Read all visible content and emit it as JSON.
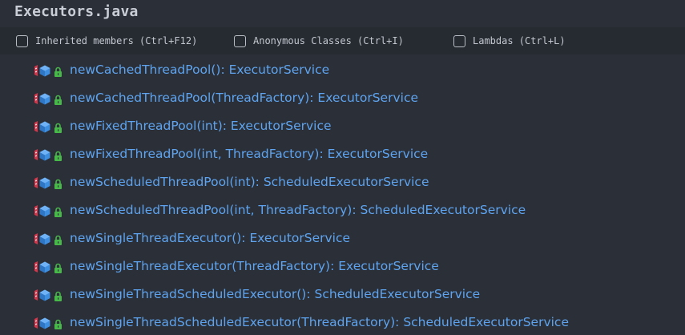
{
  "title": "Executors.java",
  "options": [
    {
      "label": "Inherited members (Ctrl+F12)",
      "checked": false
    },
    {
      "label": "Anonymous Classes (Ctrl+I)",
      "checked": false
    },
    {
      "label": "Lambdas (Ctrl+L)",
      "checked": false
    }
  ],
  "members": [
    {
      "name": "newCachedThreadPool()",
      "type": ": ExecutorService",
      "icon": "static-method-icon",
      "visibility": "lock-icon"
    },
    {
      "name": "newCachedThreadPool(ThreadFactory)",
      "type": ": ExecutorService",
      "icon": "static-method-icon",
      "visibility": "lock-icon"
    },
    {
      "name": "newFixedThreadPool(int)",
      "type": ": ExecutorService",
      "icon": "static-method-icon",
      "visibility": "lock-icon"
    },
    {
      "name": "newFixedThreadPool(int, ThreadFactory)",
      "type": ": ExecutorService",
      "icon": "static-method-icon",
      "visibility": "lock-icon"
    },
    {
      "name": "newScheduledThreadPool(int)",
      "type": ": ScheduledExecutorService",
      "icon": "static-method-icon",
      "visibility": "lock-icon"
    },
    {
      "name": "newScheduledThreadPool(int, ThreadFactory)",
      "type": ": ScheduledExecutorService",
      "icon": "static-method-icon",
      "visibility": "lock-icon"
    },
    {
      "name": "newSingleThreadExecutor()",
      "type": ": ExecutorService",
      "icon": "static-method-icon",
      "visibility": "lock-icon"
    },
    {
      "name": "newSingleThreadExecutor(ThreadFactory)",
      "type": ": ExecutorService",
      "icon": "static-method-icon",
      "visibility": "lock-icon"
    },
    {
      "name": "newSingleThreadScheduledExecutor()",
      "type": ": ScheduledExecutorService",
      "icon": "static-method-icon",
      "visibility": "lock-icon"
    },
    {
      "name": "newSingleThreadScheduledExecutor(ThreadFactory)",
      "type": ": ScheduledExecutorService",
      "icon": "static-method-icon",
      "visibility": "lock-icon"
    }
  ],
  "colors": {
    "background": "#2b2f37",
    "options_bar": "#262a31",
    "title_text": "#c9ced6",
    "member_text": "#5ea4f0",
    "method_icon_blue": "#3f8fe0",
    "static_marker_red": "#d8344a",
    "lock_green": "#48b84a"
  }
}
